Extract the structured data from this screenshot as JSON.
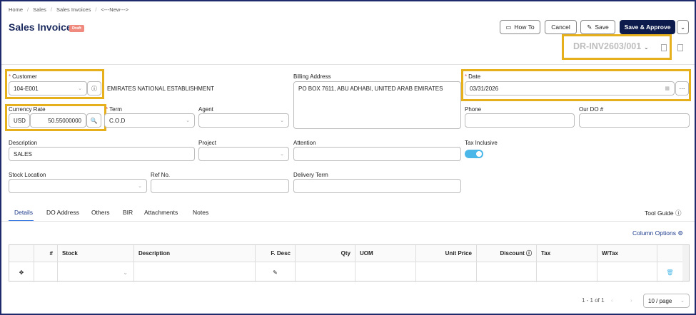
{
  "breadcrumb": [
    "Home",
    "Sales",
    "Sales Invoices",
    "<---New--->"
  ],
  "page": {
    "title": "Sales Invoice",
    "status": "Draft"
  },
  "toolbar": {
    "how_to": "How To",
    "cancel": "Cancel",
    "save": "Save",
    "save_approve": "Save & Approve"
  },
  "doc_number": "DR-INV2603/001",
  "form": {
    "customer_label": "Customer",
    "customer_code": "104-E001",
    "customer_name": "EMIRATES NATIONAL ESTABLISHMENT",
    "billing_label": "Billing Address",
    "billing_value": "PO BOX 7611, ABU ADHABI, UNITED ARAB EMIRATES",
    "date_label": "Date",
    "date_value": "03/31/2026",
    "currency_label": "Currency Rate",
    "currency_code": "USD",
    "currency_rate": "50.55000000",
    "term_label": "Term",
    "term_value": "C.O.D",
    "agent_label": "Agent",
    "phone_label": "Phone",
    "our_do_label": "Our DO #",
    "description_label": "Description",
    "description_value": "SALES",
    "project_label": "Project",
    "attention_label": "Attention",
    "tax_inclusive_label": "Tax Inclusive",
    "stock_location_label": "Stock Location",
    "ref_no_label": "Ref No.",
    "delivery_term_label": "Delivery Term"
  },
  "tabs": [
    "Details",
    "DO Address",
    "Others",
    "BIR",
    "Attachments",
    "Notes"
  ],
  "tool_guide": "Tool Guide",
  "column_options": "Column Options",
  "grid_headers": [
    "#",
    "Stock",
    "Description",
    "F. Desc",
    "Qty",
    "UOM",
    "Unit Price",
    "Discount",
    "Tax",
    "W/Tax"
  ],
  "pager": {
    "range": "1 - 1 of 1",
    "page_size": "10 / page"
  },
  "colors": {
    "primary": "#0d1b4c",
    "highlight": "#e6b01c",
    "toggle": "#4ab7e8",
    "draft": "#f08a7e"
  }
}
